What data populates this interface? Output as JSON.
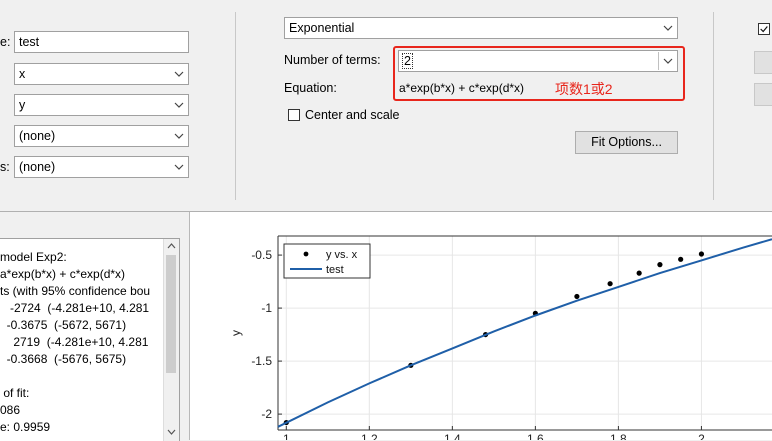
{
  "left_panel": {
    "name_label_fragment": "e:",
    "name_value": "test",
    "x_value": "x",
    "y_value": "y",
    "z_value": "(none)",
    "weights_label_fragment": "s:",
    "weights_value": "(none)"
  },
  "fit_panel": {
    "fit_type": "Exponential",
    "num_terms_label": "Number of terms:",
    "num_terms_value": "2",
    "equation_label": "Equation:",
    "equation_value": "a*exp(b*x) + c*exp(d*x)",
    "annotation_text": "项数1或2",
    "center_scale_label": "Center and scale",
    "fit_options_label": "Fit Options..."
  },
  "results": {
    "lines": [
      "model Exp2:",
      "a*exp(b*x) + c*exp(d*x)",
      "ts (with 95% confidence bou",
      "   -2724  (-4.281e+10, 4.281",
      "  -0.3675  (-5672, 5671)",
      "    2719  (-4.281e+10, 4.281",
      "  -0.3668  (-5676, 5675)",
      "",
      " of fit:",
      "086",
      "e: 0.9959"
    ]
  },
  "chart_data": {
    "type": "scatter",
    "xlabel": "",
    "ylabel": "y",
    "xlim": [
      0.98,
      2.17
    ],
    "ylim": [
      -2.15,
      -0.32
    ],
    "yticks": [
      -2,
      -1.5,
      -1,
      -0.5
    ],
    "ytick_labels": [
      "-2",
      "-1.5",
      "-1",
      "-0.5"
    ],
    "xticks": [
      1,
      1.2,
      1.4,
      1.6,
      1.8,
      2
    ],
    "xtick_labels": [
      "1",
      "1.2",
      "1.4",
      "1.6",
      "1.8",
      "2"
    ],
    "grid": true,
    "legend_position": "top-left",
    "series": [
      {
        "name": "y vs. x",
        "style": "points",
        "color": "#000000",
        "x": [
          1.0,
          1.3,
          1.48,
          1.6,
          1.7,
          1.78,
          1.85,
          1.9,
          1.95,
          2.0
        ],
        "y": [
          -2.08,
          -1.54,
          -1.25,
          -1.05,
          -0.89,
          -0.77,
          -0.67,
          -0.59,
          -0.54,
          -0.49
        ]
      },
      {
        "name": "test",
        "style": "line",
        "color": "#1f5fa8",
        "x": [
          0.98,
          1.1,
          1.2,
          1.3,
          1.4,
          1.5,
          1.6,
          1.7,
          1.8,
          1.9,
          2.0,
          2.1,
          2.17
        ],
        "y": [
          -2.12,
          -1.89,
          -1.71,
          -1.54,
          -1.38,
          -1.22,
          -1.07,
          -0.93,
          -0.8,
          -0.67,
          -0.55,
          -0.43,
          -0.35
        ]
      }
    ]
  }
}
